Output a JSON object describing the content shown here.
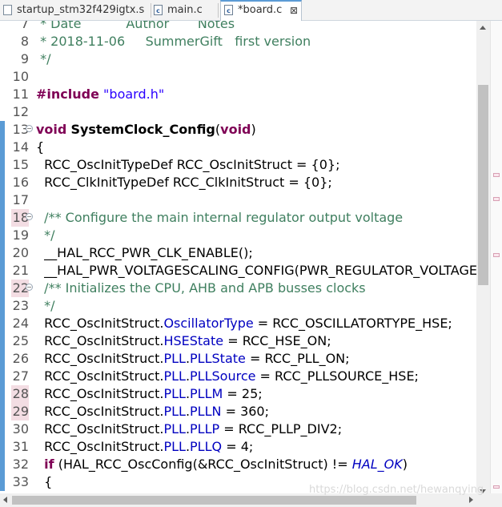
{
  "tabs": [
    {
      "label": "startup_stm32f429igtx.s",
      "active": false,
      "icon": "assembly-file-icon"
    },
    {
      "label": "main.c",
      "active": false,
      "icon": "c-file-icon"
    },
    {
      "label": "*board.c",
      "active": true,
      "icon": "c-file-icon",
      "close": "⊠"
    }
  ],
  "watermark": "https://blog.csdn.net/hewanqying",
  "colors": {
    "comment": "#3f7f5f",
    "keyword": "#7f0055",
    "string": "#2a00ff",
    "field": "#0000c0",
    "change_bar": "#5b9bd5",
    "occurrence": "#f3dde3"
  },
  "lines": [
    {
      "n": "7",
      "parts": [
        [
          "cm",
          " * Date           Author       Notes"
        ]
      ]
    },
    {
      "n": "8",
      "parts": [
        [
          "cm",
          " * 2018-11-06     SummerGift   first version"
        ]
      ]
    },
    {
      "n": "9",
      "parts": [
        [
          "cm",
          " */"
        ]
      ]
    },
    {
      "n": "10",
      "parts": []
    },
    {
      "n": "11",
      "parts": [
        [
          "kw",
          "#include"
        ],
        [
          "",
          " "
        ],
        [
          "str",
          "\"board.h\""
        ]
      ]
    },
    {
      "n": "12",
      "parts": []
    },
    {
      "n": "13",
      "fold": true,
      "bar": "mod",
      "parts": [
        [
          "kw",
          "void"
        ],
        [
          "",
          " "
        ],
        [
          "bold",
          "SystemClock_Config"
        ],
        [
          "",
          "("
        ],
        [
          "kw",
          "void"
        ],
        [
          "",
          ")"
        ]
      ]
    },
    {
      "n": "14",
      "bar": "mod",
      "parts": [
        [
          "",
          "{"
        ]
      ]
    },
    {
      "n": "15",
      "bar": "mod",
      "parts": [
        [
          "",
          "  RCC_OscInitTypeDef RCC_OscInitStruct = {0};"
        ]
      ]
    },
    {
      "n": "16",
      "bar": "mod",
      "parts": [
        [
          "",
          "  RCC_ClkInitTypeDef RCC_ClkInitStruct = {0};"
        ]
      ]
    },
    {
      "n": "17",
      "bar": "mod",
      "parts": []
    },
    {
      "n": "18",
      "fold": true,
      "bar": "mod",
      "hl": true,
      "parts": [
        [
          "cm",
          "  /** Configure the main internal regulator output voltage"
        ]
      ]
    },
    {
      "n": "19",
      "bar": "mod",
      "parts": [
        [
          "cm",
          "  */"
        ]
      ]
    },
    {
      "n": "20",
      "bar": "mod",
      "parts": [
        [
          "",
          "  __HAL_RCC_PWR_CLK_ENABLE();"
        ]
      ]
    },
    {
      "n": "21",
      "bar": "mod",
      "parts": [
        [
          "",
          "  __HAL_PWR_VOLTAGESCALING_CONFIG(PWR_REGULATOR_VOLTAGE_S"
        ]
      ]
    },
    {
      "n": "22",
      "fold": true,
      "bar": "mod",
      "hl": true,
      "parts": [
        [
          "cm",
          "  /** Initializes the CPU, AHB and APB busses clocks"
        ]
      ]
    },
    {
      "n": "23",
      "bar": "mod",
      "parts": [
        [
          "cm",
          "  */"
        ]
      ]
    },
    {
      "n": "24",
      "bar": "mod",
      "parts": [
        [
          "",
          "  RCC_OscInitStruct."
        ],
        [
          "fld",
          "OscillatorType"
        ],
        [
          "",
          " = RCC_OSCILLATORTYPE_HSE;"
        ]
      ]
    },
    {
      "n": "25",
      "bar": "mod",
      "parts": [
        [
          "",
          "  RCC_OscInitStruct."
        ],
        [
          "fld",
          "HSEState"
        ],
        [
          "",
          " = RCC_HSE_ON;"
        ]
      ]
    },
    {
      "n": "26",
      "bar": "mod",
      "parts": [
        [
          "",
          "  RCC_OscInitStruct."
        ],
        [
          "fld",
          "PLL"
        ],
        [
          "",
          "."
        ],
        [
          "fld",
          "PLLState"
        ],
        [
          "",
          " = RCC_PLL_ON;"
        ]
      ]
    },
    {
      "n": "27",
      "bar": "mod",
      "parts": [
        [
          "",
          "  RCC_OscInitStruct."
        ],
        [
          "fld",
          "PLL"
        ],
        [
          "",
          "."
        ],
        [
          "fld",
          "PLLSource"
        ],
        [
          "",
          " = RCC_PLLSOURCE_HSE;"
        ]
      ]
    },
    {
      "n": "28",
      "bar": "mod",
      "hl": true,
      "parts": [
        [
          "",
          "  RCC_OscInitStruct."
        ],
        [
          "fld",
          "PLL"
        ],
        [
          "",
          "."
        ],
        [
          "fld",
          "PLLM"
        ],
        [
          "",
          " = 25;"
        ]
      ]
    },
    {
      "n": "29",
      "bar": "mod",
      "hl": true,
      "parts": [
        [
          "",
          "  RCC_OscInitStruct."
        ],
        [
          "fld",
          "PLL"
        ],
        [
          "",
          "."
        ],
        [
          "fld",
          "PLLN"
        ],
        [
          "",
          " = 360;"
        ]
      ]
    },
    {
      "n": "30",
      "bar": "mod",
      "parts": [
        [
          "",
          "  RCC_OscInitStruct."
        ],
        [
          "fld",
          "PLL"
        ],
        [
          "",
          "."
        ],
        [
          "fld",
          "PLLP"
        ],
        [
          "",
          " = RCC_PLLP_DIV2;"
        ]
      ]
    },
    {
      "n": "31",
      "bar": "mod",
      "parts": [
        [
          "",
          "  RCC_OscInitStruct."
        ],
        [
          "fld",
          "PLL"
        ],
        [
          "",
          "."
        ],
        [
          "fld",
          "PLLQ"
        ],
        [
          "",
          " = 4;"
        ]
      ]
    },
    {
      "n": "32",
      "bar": "mod",
      "parts": [
        [
          "",
          "  "
        ],
        [
          "kw",
          "if"
        ],
        [
          "",
          " (HAL_RCC_OscConfig(&RCC_OscInitStruct) != "
        ],
        [
          "ital",
          "HAL_OK"
        ],
        [
          "",
          ")"
        ]
      ]
    },
    {
      "n": "33",
      "bar": "mod",
      "parts": [
        [
          "",
          "  {"
        ]
      ]
    }
  ]
}
